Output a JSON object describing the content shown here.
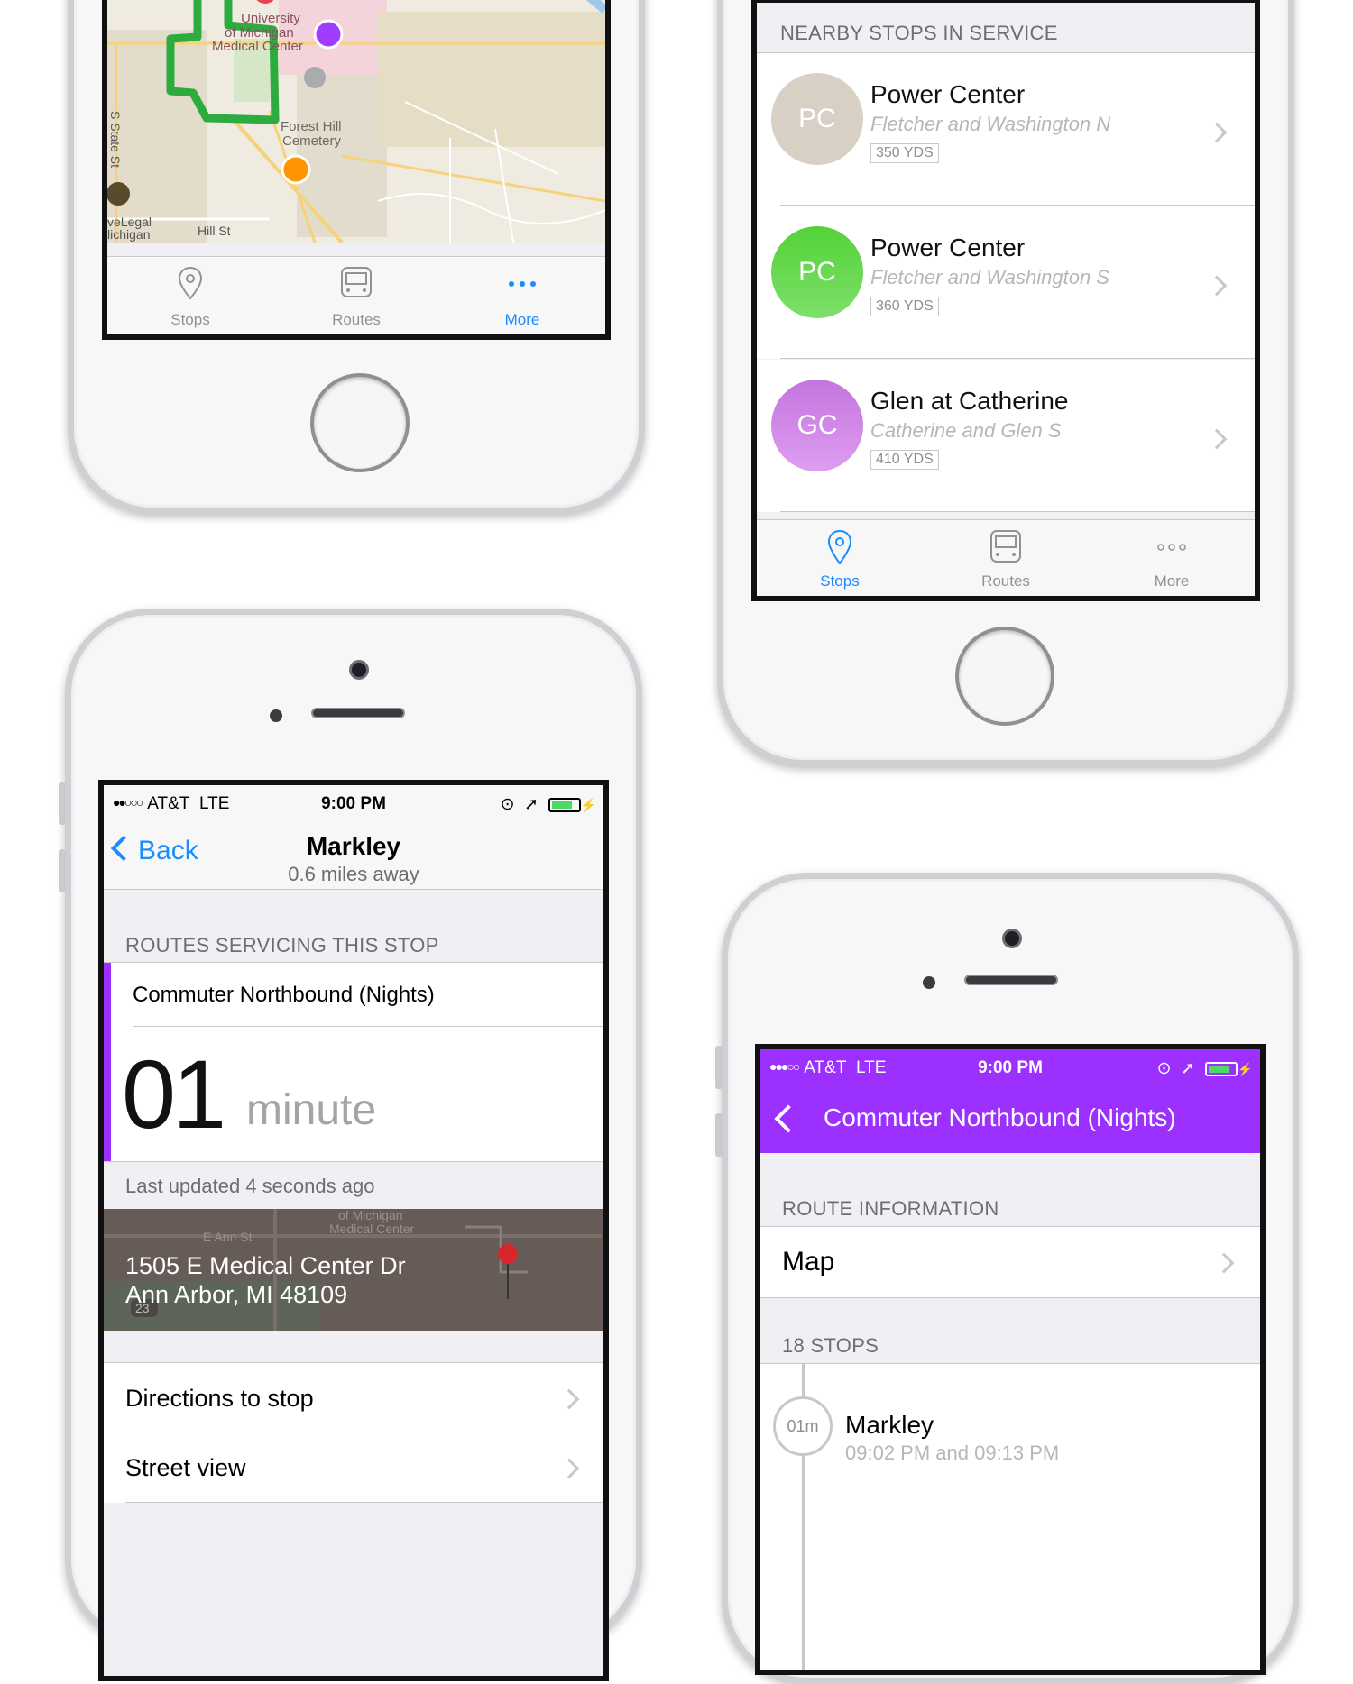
{
  "phone1": {
    "map": {
      "labels": {
        "university": "University of Michigan Medical Center",
        "cemetery": "Forest Hill Cemetery",
        "street_state": "S State St",
        "street_hill": "Hill St",
        "legal": "Legal",
        "umich": "versity of Michigan"
      },
      "route_color": "#2dab3f",
      "pin_purple": "#a03cff",
      "pin_orange": "#ff9500"
    },
    "tabs": [
      {
        "label": "Stops",
        "icon": "map-pin-icon"
      },
      {
        "label": "Routes",
        "icon": "bus-icon"
      },
      {
        "label": "More",
        "icon": "more-icon",
        "active": true
      }
    ]
  },
  "phone2": {
    "section_header": "NEARBY STOPS IN SERVICE",
    "stops": [
      {
        "initials": "PC",
        "name": "Power Center",
        "sub": "Fletcher and Washington N",
        "distance": "350 YDS",
        "color": "#d8d0c4"
      },
      {
        "initials": "PC",
        "name": "Power Center",
        "sub": "Fletcher and Washington S",
        "distance": "360 YDS",
        "color": "#5bd24a"
      },
      {
        "initials": "GC",
        "name": "Glen at Catherine",
        "sub": "Catherine and Glen S",
        "distance": "410 YDS",
        "color": "#c97be0"
      }
    ],
    "tabs": [
      {
        "label": "Stops",
        "icon": "map-pin-icon",
        "active": true
      },
      {
        "label": "Routes",
        "icon": "bus-icon"
      },
      {
        "label": "More",
        "icon": "more-icon"
      }
    ]
  },
  "phone3": {
    "status": {
      "carrier": "AT&T",
      "network": "LTE",
      "time": "9:00 PM"
    },
    "nav": {
      "back_label": "Back",
      "title": "Markley",
      "subtitle": "0.6 miles away"
    },
    "section_header": "ROUTES SERVICING THIS STOP",
    "route_name": "Commuter Northbound (Nights)",
    "countdown": {
      "value": "01",
      "unit": "minute"
    },
    "last_updated": "Last updated 4 seconds ago",
    "address": {
      "line1": "1505 E Medical Center Dr",
      "line2": "Ann Arbor, MI 48109"
    },
    "map_labels": {
      "medical": "of Michigan Medical Center",
      "street": "E Ann St",
      "route": "23"
    },
    "actions": [
      {
        "label": "Directions to stop"
      },
      {
        "label": "Street view"
      }
    ],
    "accent": "#9b30ff"
  },
  "phone4": {
    "status": {
      "carrier": "AT&T",
      "network": "LTE",
      "time": "9:00 PM"
    },
    "nav": {
      "title": "Commuter Northbound (Nights)"
    },
    "section_route_info": "ROUTE INFORMATION",
    "map_row": "Map",
    "section_stops": "18 STOPS",
    "stop": {
      "eta": "01m",
      "name": "Markley",
      "times": "09:02 PM and 09:13 PM"
    },
    "accent": "#9b30ff"
  }
}
